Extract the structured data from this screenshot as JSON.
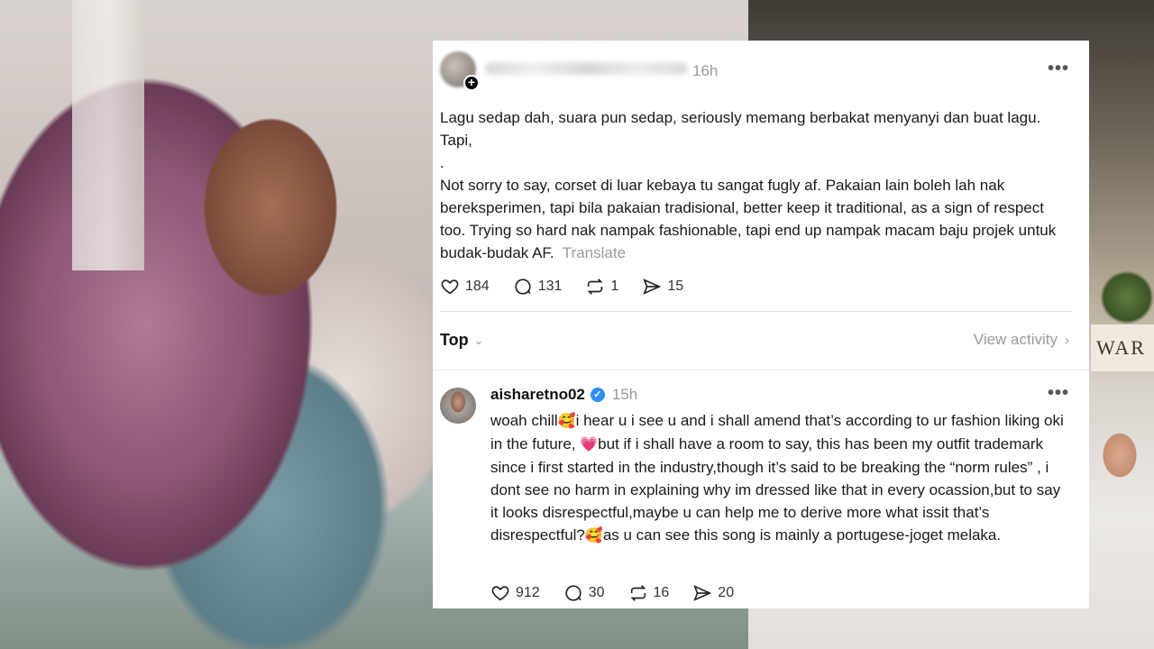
{
  "original_post": {
    "time": "16h",
    "more_label": "•••",
    "follow_label": "+",
    "text_lines": [
      "Lagu sedap dah, suara pun sedap, seriously memang berbakat menyanyi dan buat lagu. Tapi,",
      ".",
      "Not sorry to say, corset di luar kebaya tu sangat fugly af. Pakaian lain boleh lah nak bereksperimen, tapi bila pakaian tradisional, better keep it traditional, as a sign of respect too. Trying so hard nak nampak fashionable, tapi end up nampak macam baju projek untuk budak-budak AF."
    ],
    "translate_label": "Translate",
    "likes": "184",
    "comments": "131",
    "reposts": "1",
    "shares": "15"
  },
  "sort": {
    "label": "Top",
    "view_activity_label": "View activity"
  },
  "reply": {
    "username": "aisharetno02",
    "verified_mark": "✓",
    "time": "15h",
    "more_label": "•••",
    "text_part1": "woah chill",
    "emoji1": "🥰",
    "text_part2": "i hear u i see u and i shall amend that’s according to ur fashion liking oki in the future, ",
    "emoji2": "💗",
    "text_part3": "but if i shall have a room to say, this has been my outfit trademark since i first started in the industry,though it’s said to be breaking the “norm rules” , i dont see no harm in explaining why im dressed like that in every ocassion,but to say it looks disrespectful,maybe u can help me to derive more what issit that’s disrespectful?",
    "emoji3": "🥰",
    "text_part4": "as u can see this song is mainly a portugese-joget melaka.",
    "likes": "912",
    "comments": "30",
    "reposts": "16",
    "shares": "20"
  },
  "background": {
    "sign_text": "WAR"
  }
}
